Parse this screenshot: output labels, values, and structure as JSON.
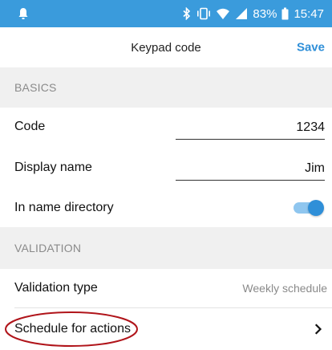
{
  "status_bar": {
    "battery_percent": "83%",
    "time": "15:47",
    "icons": [
      "notification-bell-icon",
      "bluetooth-icon",
      "vibrate-icon",
      "wifi-icon",
      "cellular-signal-icon",
      "battery-icon"
    ],
    "background": "#3a9bdc"
  },
  "header": {
    "title": "Keypad code",
    "save_label": "Save",
    "accent": "#2f8fd8"
  },
  "sections": {
    "basics": "BASICS",
    "validation": "VALIDATION"
  },
  "fields": {
    "code": {
      "label": "Code",
      "value": "1234"
    },
    "display_name": {
      "label": "Display name",
      "value": "Jim"
    },
    "name_directory": {
      "label": "In name directory",
      "enabled": true
    },
    "validation_type": {
      "label": "Validation type",
      "value": "Weekly schedule"
    },
    "schedule": {
      "label": "Schedule for actions",
      "icon": "chevron-right-icon"
    }
  },
  "annotation": {
    "shape": "ellipse",
    "color": "#b0141a"
  }
}
